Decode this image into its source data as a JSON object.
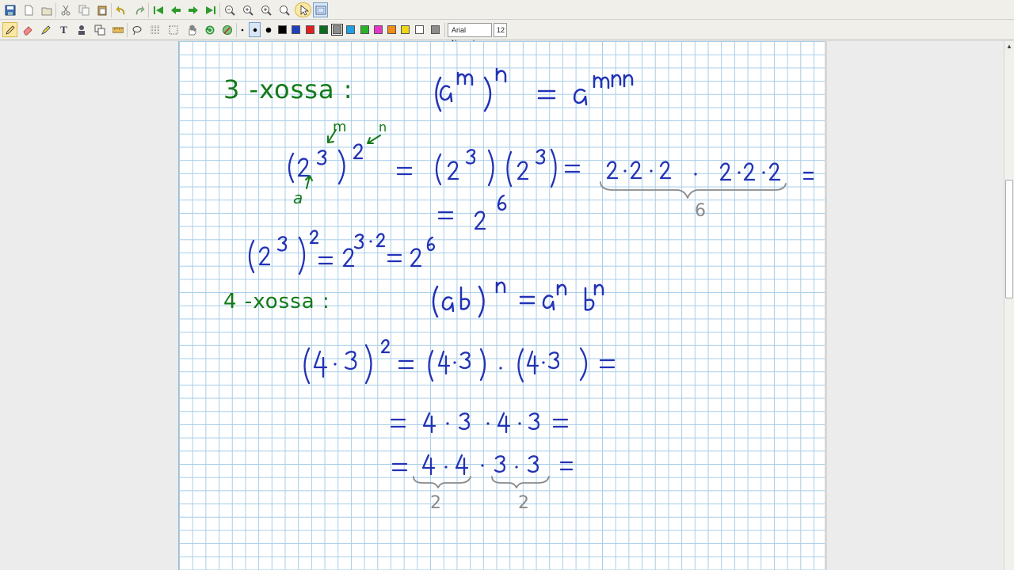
{
  "toolbar_top": {
    "icons": [
      "save-icon",
      "new-page-icon",
      "open-folder-icon",
      "cut-icon",
      "copy-icon",
      "paste-icon",
      "undo-icon",
      "redo-icon",
      "first-page-icon",
      "previous-page-icon",
      "next-page-icon",
      "last-page-icon",
      "zoom-out-icon",
      "zoom-in-icon",
      "zoom-fit-icon",
      "zoom-page-icon",
      "pointer-icon",
      "fullscreen-icon"
    ]
  },
  "toolbar_tools": {
    "icons": [
      "pen-icon",
      "eraser-icon",
      "highlighter-icon",
      "text-icon",
      "stamp-icon",
      "shapes-icon",
      "ruler-icon",
      "lasso-icon",
      "grid-icon",
      "select-area-icon",
      "hand-icon",
      "refresh-icon",
      "fill-icon"
    ],
    "colors": [
      "#000000",
      "#1f3fbf",
      "#e02020",
      "#0b6b1e",
      "#8c8c8c",
      "#1ea0e6",
      "#28b428",
      "#e636c8",
      "#f58a14",
      "#f0d614",
      "#ffffff",
      "#8c8c8c"
    ],
    "font_name": "Arial Normal",
    "font_size": "12"
  },
  "ink_colors": {
    "green": "#127a18",
    "blue": "#2233b5",
    "gray": "#8a8a8a"
  },
  "notes": {
    "heading3": "3 -xossa :",
    "heading4": "4 -xossa :",
    "label_m": "m",
    "label_n": "n",
    "label_a": "a",
    "brace_count_6": "6",
    "brace_count_2a": "2",
    "brace_count_2b": "2"
  }
}
